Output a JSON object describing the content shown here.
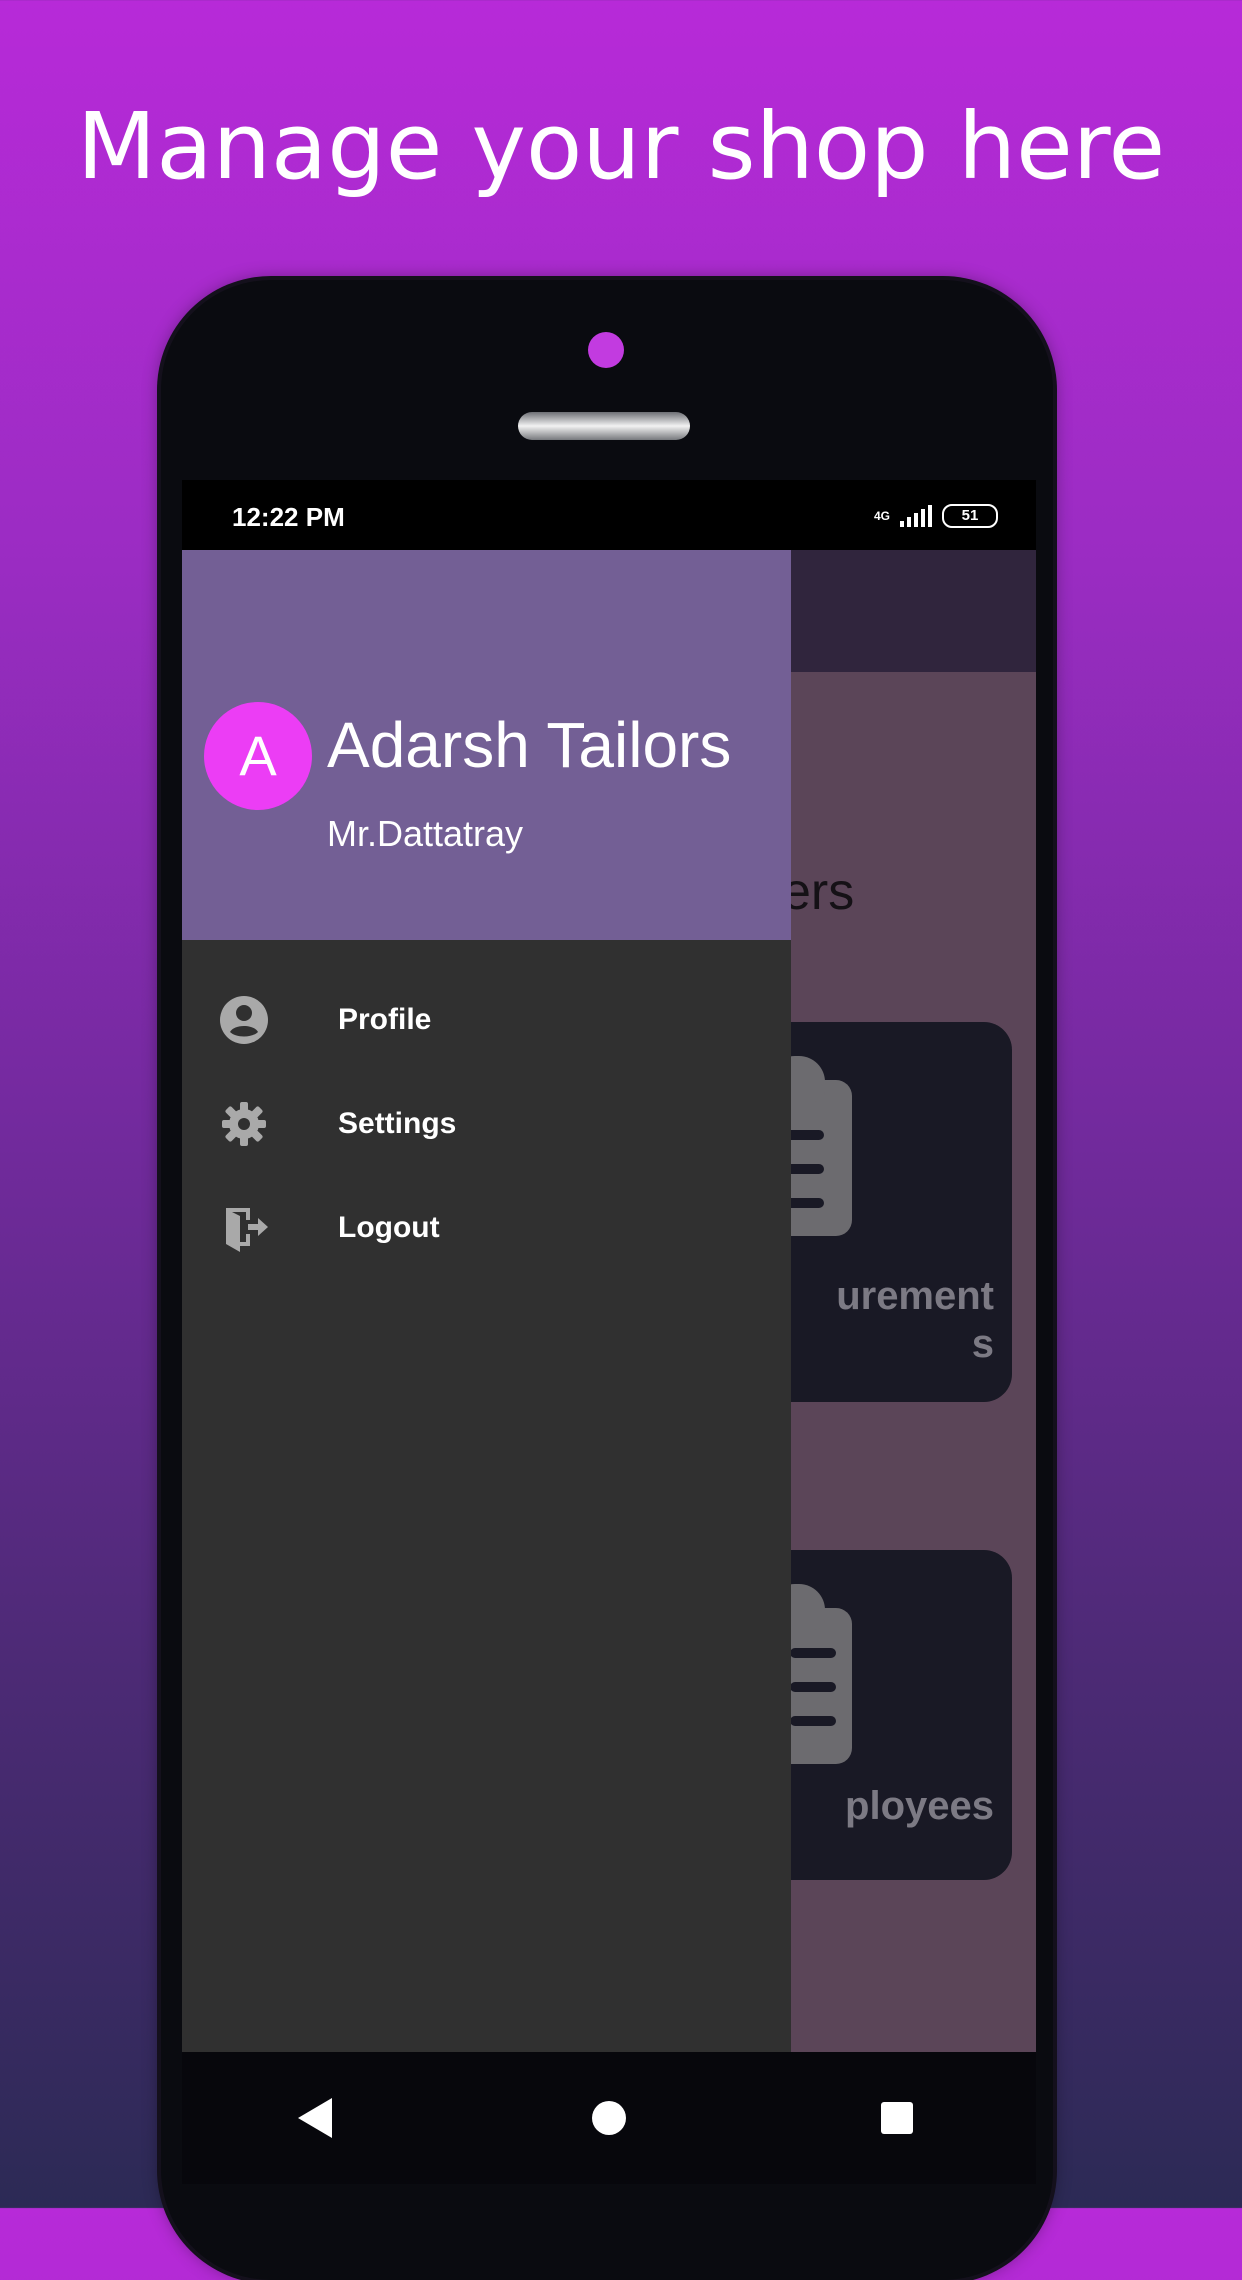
{
  "marketing": {
    "headline": "Manage your shop here"
  },
  "statusbar": {
    "time": "12:22 PM",
    "network": "4G",
    "battery": "51"
  },
  "background": {
    "section_heading_fragment": "ers",
    "cards": [
      {
        "label": "urement\ns"
      },
      {
        "label": "ployees"
      }
    ]
  },
  "drawer": {
    "avatar_letter": "A",
    "shop_name": "Adarsh Tailors",
    "owner_name": "Mr.Dattatray",
    "menu": [
      {
        "label": "Profile",
        "icon": "profile-icon"
      },
      {
        "label": "Settings",
        "icon": "gear-icon"
      },
      {
        "label": "Logout",
        "icon": "logout-icon"
      }
    ]
  },
  "navbar": {
    "back_icon": "back-icon",
    "home_icon": "home-icon",
    "recents_icon": "recents-icon"
  },
  "colors": {
    "gradient_top": "#b72ad8",
    "gradient_bottom": "#2c2a55",
    "drawer_header": "#735f95",
    "avatar": "#ec3df5",
    "drawer_body": "#303030"
  }
}
